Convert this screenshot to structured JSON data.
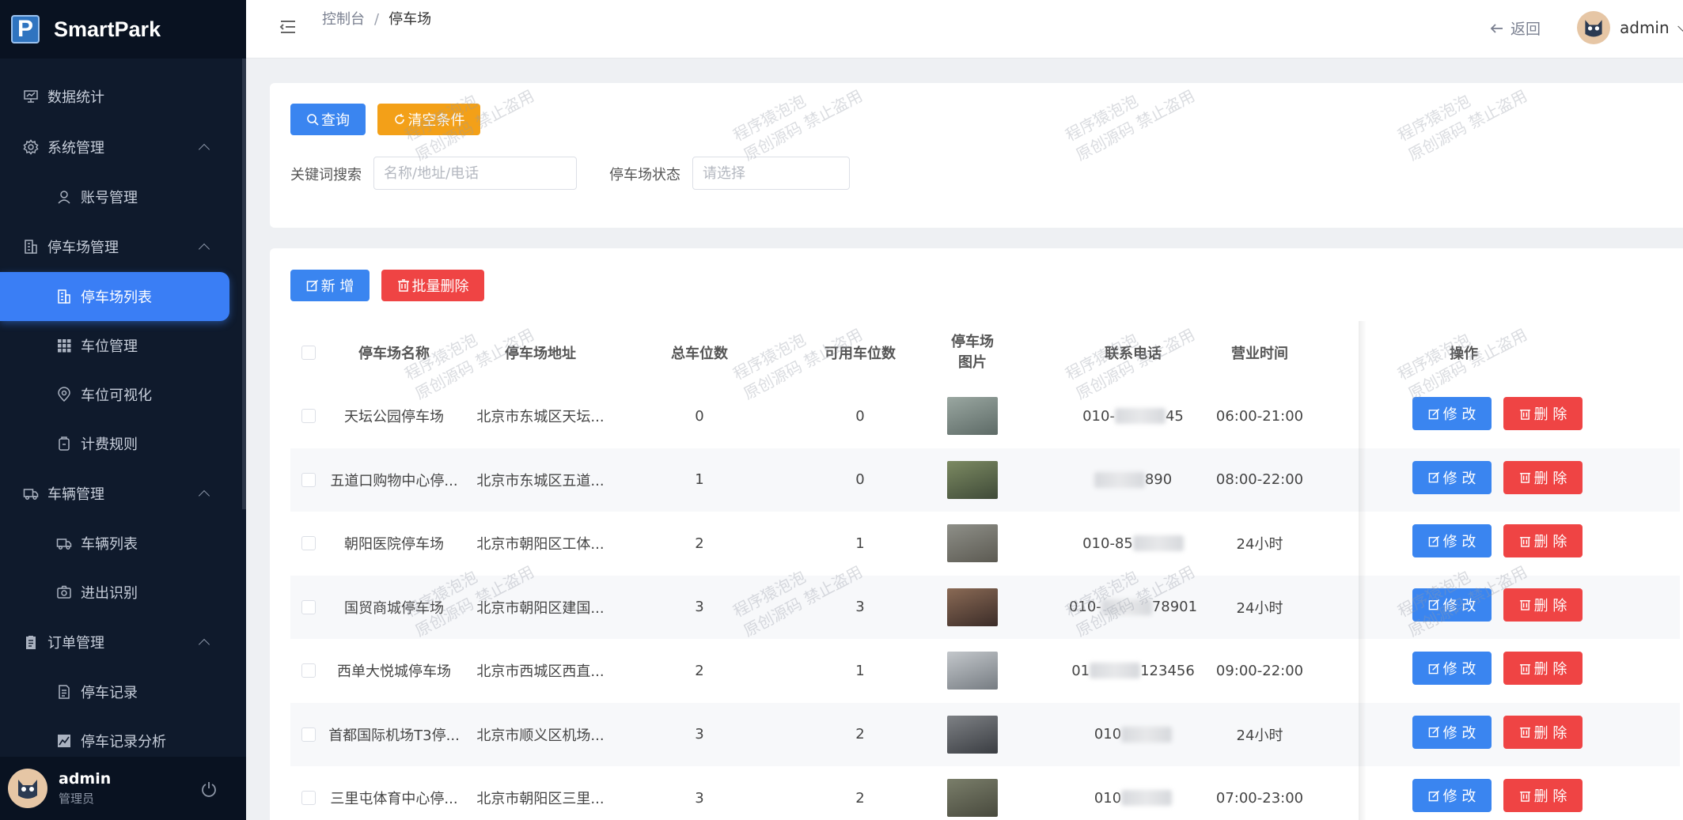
{
  "app": {
    "name": "SmartPark",
    "logo_letter": "P"
  },
  "sidebar": {
    "items": [
      {
        "label": "数据统计",
        "icon": "chart-board-icon",
        "level": 1
      },
      {
        "label": "系统管理",
        "icon": "gear-icon",
        "level": 1,
        "expanded": true
      },
      {
        "label": "账号管理",
        "icon": "user-icon",
        "level": 2
      },
      {
        "label": "停车场管理",
        "icon": "building-icon",
        "level": 1,
        "expanded": true
      },
      {
        "label": "停车场列表",
        "icon": "building-icon",
        "level": 2,
        "active": true
      },
      {
        "label": "车位管理",
        "icon": "grid-icon",
        "level": 2
      },
      {
        "label": "车位可视化",
        "icon": "map-pin-icon",
        "level": 2
      },
      {
        "label": "计费规则",
        "icon": "price-tag-icon",
        "level": 2
      },
      {
        "label": "车辆管理",
        "icon": "truck-icon",
        "level": 1,
        "expanded": true
      },
      {
        "label": "车辆列表",
        "icon": "truck-icon",
        "level": 2
      },
      {
        "label": "进出识别",
        "icon": "camera-icon",
        "level": 2
      },
      {
        "label": "订单管理",
        "icon": "clipboard-icon",
        "level": 1,
        "expanded": true
      },
      {
        "label": "停车记录",
        "icon": "document-icon",
        "level": 2
      },
      {
        "label": "停车记录分析",
        "icon": "line-chart-icon",
        "level": 2
      }
    ],
    "user": {
      "name": "admin",
      "role": "管理员"
    }
  },
  "header": {
    "breadcrumb": [
      "控制台",
      "停车场"
    ],
    "separator": "/",
    "back_label": "返回",
    "username": "admin"
  },
  "search": {
    "query_label": "查询",
    "clear_label": "清空条件",
    "keyword_label": "关键词搜索",
    "keyword_placeholder": "名称/地址/电话",
    "status_label": "停车场状态",
    "status_placeholder": "请选择"
  },
  "toolbar": {
    "add_label": "新 增",
    "batch_delete_label": "批量删除"
  },
  "table": {
    "columns": [
      "停车场名称",
      "停车场地址",
      "总车位数",
      "可用车位数",
      "停车场图片",
      "联系电话",
      "营业时间",
      "操作"
    ],
    "edit_label": "修 改",
    "delete_label": "删 除",
    "rows": [
      {
        "name": "天坛公园停车场",
        "address": "北京市东城区天坛...",
        "total": "0",
        "available": "0",
        "phone_pre": "010-",
        "phone_post": "45",
        "hours": "06:00-21:00",
        "img": [
          "#9aa7a1",
          "#5d6a66"
        ]
      },
      {
        "name": "五道口购物中心停...",
        "address": "北京市东城区五道...",
        "total": "1",
        "available": "0",
        "phone_pre": "",
        "phone_post": "890",
        "hours": "08:00-22:00",
        "img": [
          "#7c8a62",
          "#3f4a38"
        ]
      },
      {
        "name": "朝阳医院停车场",
        "address": "北京市朝阳区工体...",
        "total": "2",
        "available": "1",
        "phone_pre": "010-85",
        "phone_post": "",
        "hours": "24小时",
        "img": [
          "#8e8f88",
          "#5c5a52"
        ]
      },
      {
        "name": "国贸商城停车场",
        "address": "北京市朝阳区建国...",
        "total": "3",
        "available": "3",
        "phone_pre": "010-",
        "phone_post": "78901",
        "hours": "24小时",
        "img": [
          "#8a6a55",
          "#3b2c28"
        ]
      },
      {
        "name": "西单大悦城停车场",
        "address": "北京市西城区西直...",
        "total": "2",
        "available": "1",
        "phone_pre": "01",
        "phone_post": "123456",
        "hours": "09:00-22:00",
        "img": [
          "#c3c7cb",
          "#767c82"
        ]
      },
      {
        "name": "首都国际机场T3停...",
        "address": "北京市顺义区机场...",
        "total": "3",
        "available": "2",
        "phone_pre": "010",
        "phone_post": "",
        "hours": "24小时",
        "img": [
          "#7e8185",
          "#3a3d42"
        ]
      },
      {
        "name": "三里屯体育中心停...",
        "address": "北京市朝阳区三里...",
        "total": "3",
        "available": "2",
        "phone_pre": "010",
        "phone_post": "",
        "hours": "07:00-23:00",
        "img": [
          "#7a7e6a",
          "#48493d"
        ]
      }
    ]
  },
  "watermark": {
    "line1": "程序猿泡泡",
    "line2": "原创源码 禁止盗用"
  },
  "colors": {
    "primary": "#3a85f0",
    "warning": "#f3a018",
    "danger": "#ef4444",
    "sidebar": "#0f1a2c"
  }
}
